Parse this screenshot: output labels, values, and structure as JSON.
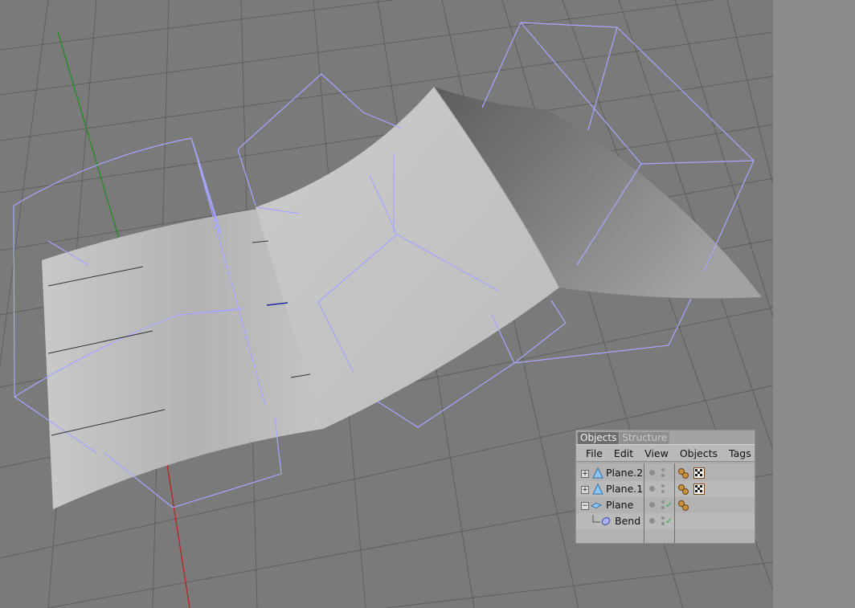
{
  "objects_manager": {
    "tabs": [
      {
        "label": "Objects",
        "active": true
      },
      {
        "label": "Structure",
        "active": false
      }
    ],
    "menu": [
      "File",
      "Edit",
      "View",
      "Objects",
      "Tags"
    ],
    "objects": [
      {
        "name": "Plane.2",
        "icon": "triangle-icon",
        "expander": "+",
        "tags": [
          "material-tag-icon",
          "checker-texture-tag-icon"
        ]
      },
      {
        "name": "Plane.1",
        "icon": "triangle-icon",
        "expander": "+",
        "tags": [
          "material-tag-icon",
          "checker-texture-tag-icon"
        ]
      },
      {
        "name": "Plane",
        "icon": "plane-icon",
        "expander": "−",
        "enabled_check": true,
        "tags": [
          "material-tag-icon"
        ]
      },
      {
        "name": "Bend",
        "icon": "bend-deformer-icon",
        "child": true,
        "enabled_check": true,
        "tags": []
      }
    ]
  },
  "colors": {
    "viewport_bg": "#7a7a7a",
    "grid": "#5e5e5e",
    "deformer_wire": "#a7a6ff",
    "x_axis": "#b82323",
    "y_axis": "#2e8a2e",
    "surface_light": "#c6c6c6",
    "surface_dark": "#6a6a6a"
  }
}
